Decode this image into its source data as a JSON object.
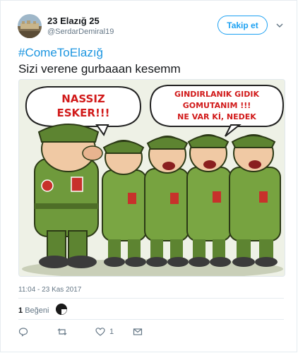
{
  "user": {
    "display_name": "23 Elazığ 25",
    "handle": "@SerdarDemiral19",
    "follow_label": "Takip et"
  },
  "tweet": {
    "hashtag": "#ComeToElazığ",
    "text": "Sizi verene gurbaaan kesemm",
    "timestamp": "11:04 - 23 Kas 2017"
  },
  "comic": {
    "bubble_left": [
      "NASSIZ",
      "ESKER!!!"
    ],
    "bubble_right": [
      "GINDIRLANIK GIDIK",
      "GOMUTANIM !!!",
      "NE VAR Kİ, NEDEK"
    ]
  },
  "stats": {
    "like_count": "1",
    "like_label": "Beğeni"
  },
  "actions": {
    "like_count": "1"
  },
  "colors": {
    "accent": "#1da1f2",
    "hashtag": "#1b95e0",
    "muted": "#657786"
  }
}
